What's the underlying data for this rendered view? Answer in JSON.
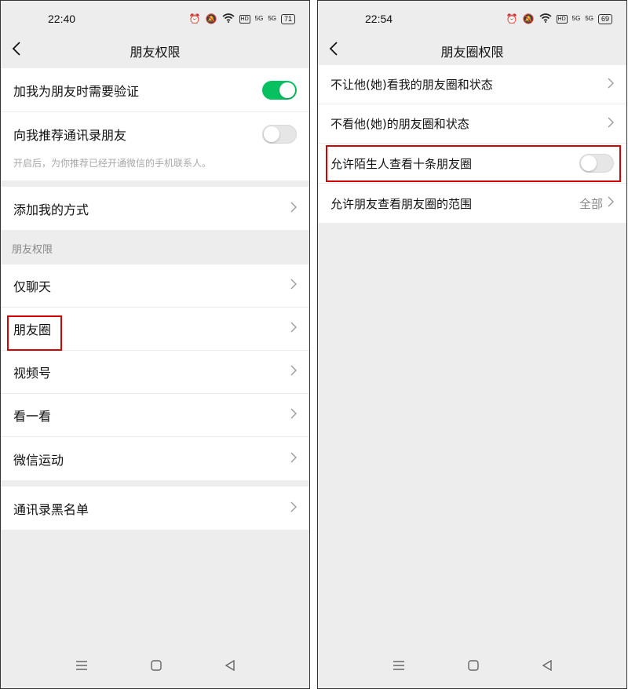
{
  "left": {
    "status": {
      "time": "22:40",
      "battery": "71",
      "hd": "HD",
      "sig1": "5G",
      "sig2": "5G"
    },
    "title": "朋友权限",
    "rows": {
      "verify": "加我为朋友时需要验证",
      "recommend": "向我推荐通讯录朋友",
      "recommend_note": "开启后，为你推荐已经开通微信的手机联系人。",
      "add_ways": "添加我的方式",
      "section_title": "朋友权限",
      "chat_only": "仅聊天",
      "moments": "朋友圈",
      "channels": "视频号",
      "top_stories": "看一看",
      "werun": "微信运动",
      "blacklist": "通讯录黑名单"
    },
    "toggles": {
      "verify": "on",
      "recommend": "off"
    }
  },
  "right": {
    "status": {
      "time": "22:54",
      "battery": "69",
      "hd": "HD",
      "sig1": "5G",
      "sig2": "5G"
    },
    "title": "朋友圈权限",
    "rows": {
      "hide_my_moments": "不让他(她)看我的朋友圈和状态",
      "hide_their_moments": "不看他(她)的朋友圈和状态",
      "stranger_ten": "允许陌生人查看十条朋友圈",
      "range": "允许朋友查看朋友圈的范围",
      "range_value": "全部"
    },
    "toggles": {
      "stranger_ten": "off"
    }
  },
  "icons": {
    "back": "back-chevron-icon",
    "chevron": "chevron-right-icon",
    "nav_menu": "menu-icon",
    "nav_home": "home-icon",
    "nav_back": "back-triangle-icon"
  },
  "colors": {
    "toggle_on": "#07c160",
    "highlight": "#d40000",
    "background": "#ededed"
  }
}
